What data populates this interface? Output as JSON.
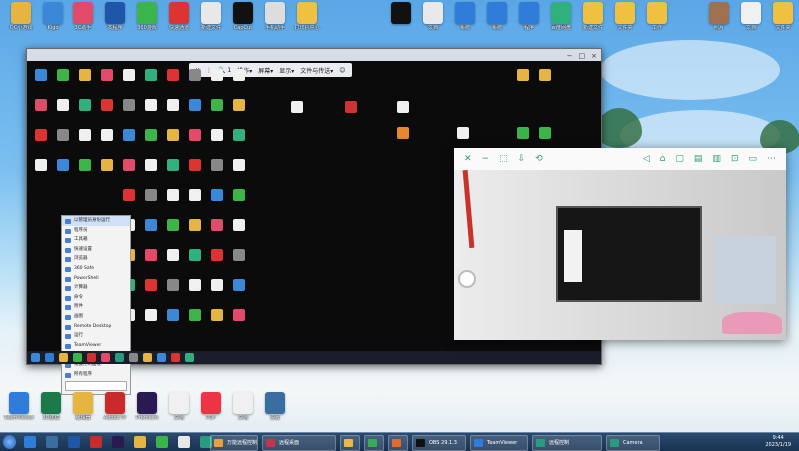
{
  "colors": {
    "sky_top": "#5aa6e6",
    "taskbar": "#183251",
    "remote_bg": "#0b0b0b",
    "cam_accent": "#2a9b7f"
  },
  "desktop_top_row": [
    {
      "label": "QC小游戏",
      "color": "#e6b440"
    },
    {
      "label": "Kigo",
      "color": "#3b88d9"
    },
    {
      "label": "3C助手",
      "color": "#e24a6a"
    },
    {
      "label": "本程序",
      "color": "#1e56a8"
    },
    {
      "label": "360游戏",
      "color": "#3bb54a"
    },
    {
      "label": "快速通道",
      "color": "#d33"
    },
    {
      "label": "新建文件",
      "color": "#e8e8e8"
    },
    {
      "label": "CapCut",
      "color": "#111"
    },
    {
      "label": "手机助手",
      "color": "#ddd"
    },
    {
      "label": "打印机中心",
      "color": "#f0c040"
    },
    {
      "label": "",
      "color": "#111"
    },
    {
      "label": "文档",
      "color": "#e9e9e9"
    },
    {
      "label": "系统",
      "color": "#2f7dd8"
    },
    {
      "label": "系统",
      "color": "#2f7dd8"
    },
    {
      "label": "程序",
      "color": "#2f7dd8"
    },
    {
      "label": "百度网盘",
      "color": "#2fb07c"
    },
    {
      "label": "新建文件",
      "color": "#f0c040"
    },
    {
      "label": "文件夹",
      "color": "#f0c040"
    },
    {
      "label": "工作",
      "color": "#f0c040"
    },
    {
      "label": "照片",
      "color": "#a07050"
    },
    {
      "label": "文档",
      "color": "#f0f0f0"
    },
    {
      "label": "文件夹",
      "color": "#f0c040"
    }
  ],
  "remote_window": {
    "title": "",
    "toolbar": [
      "✕",
      "⋮",
      "🔍 1",
      "操作▾",
      "屏幕▾",
      "显示▾",
      "文件与传送▾",
      "😊"
    ]
  },
  "start_menu_items": [
    "以管理员身份运行",
    "程序员",
    "工具箱",
    "快速设置",
    "浏览器",
    "360 Safe",
    "PowerShell",
    "计算器",
    "命令",
    "附件",
    "画图",
    "Remote Desktop",
    "运行",
    "TeamViewer",
    "Adobe Photoshop",
    "设置控制面板",
    "所有程序"
  ],
  "camera_window": {
    "left_icons": [
      "✕",
      "−",
      "⬚",
      "⇩",
      "⟲"
    ],
    "right_icons": [
      "◁",
      "⌂",
      "▢",
      "▤",
      "▥",
      "⊡",
      "▭",
      "⋯"
    ]
  },
  "bottom_desktop_row": [
    {
      "label": "TeamViewer",
      "color": "#2f7dd8"
    },
    {
      "label": "3D建模",
      "color": "#1a7a4a"
    },
    {
      "label": "编辑器",
      "color": "#e6b440"
    },
    {
      "label": "Adobe Pr",
      "color": "#c92b2b"
    },
    {
      "label": "Premiere",
      "color": "#2b1a52"
    },
    {
      "label": "文档",
      "color": "#f0f0f0"
    },
    {
      "label": "PDF",
      "color": "#e34"
    },
    {
      "label": "文档",
      "color": "#f0f0f0"
    },
    {
      "label": "设置",
      "color": "#3b6ea0"
    }
  ],
  "taskbar": {
    "windows": [
      {
        "label": "万能远程控制",
        "color": "#e8a23a"
      },
      {
        "label": "远程桌面",
        "color": "#c9334a"
      },
      {
        "label": "",
        "color": "#e8b94a"
      },
      {
        "label": "",
        "color": "#3aaa5a"
      },
      {
        "label": "",
        "color": "#e26a2a"
      },
      {
        "label": "OBS 29.1.3",
        "color": "#111"
      },
      {
        "label": "TeamViewer",
        "color": "#2f7dd8"
      },
      {
        "label": "远程控制",
        "color": "#2a9b7f"
      },
      {
        "label": "Camera",
        "color": "#2a9b7f"
      }
    ],
    "clock_time": "9:44",
    "clock_date": "2023/1/19"
  }
}
